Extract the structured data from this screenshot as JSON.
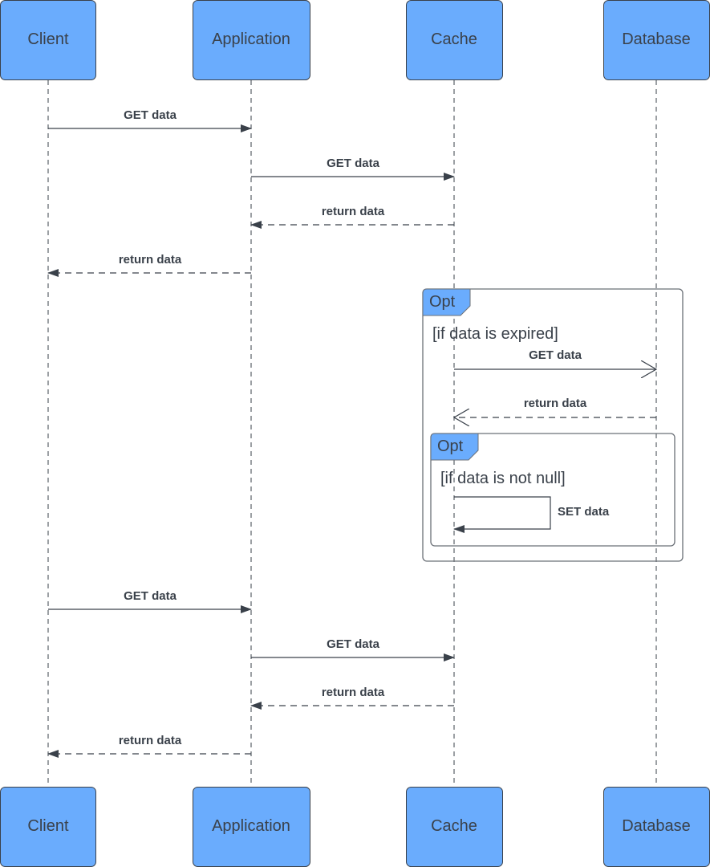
{
  "diagram": {
    "type": "sequence",
    "actors": [
      {
        "id": "client",
        "label": "Client"
      },
      {
        "id": "application",
        "label": "Application"
      },
      {
        "id": "cache",
        "label": "Cache"
      },
      {
        "id": "database",
        "label": "Database"
      }
    ],
    "messages": [
      {
        "label": "GET data",
        "from": "client",
        "to": "application",
        "style": "solid",
        "arrow": "filled"
      },
      {
        "label": "GET data",
        "from": "application",
        "to": "cache",
        "style": "solid",
        "arrow": "filled"
      },
      {
        "label": "return data",
        "from": "cache",
        "to": "application",
        "style": "dashed",
        "arrow": "filled"
      },
      {
        "label": "return data",
        "from": "application",
        "to": "client",
        "style": "dashed",
        "arrow": "filled"
      },
      {
        "label": "GET data",
        "from": "cache",
        "to": "database",
        "style": "solid",
        "arrow": "open"
      },
      {
        "label": "return data",
        "from": "database",
        "to": "cache",
        "style": "dashed",
        "arrow": "open"
      },
      {
        "label": "SET data",
        "from": "cache",
        "to": "cache",
        "style": "solid",
        "arrow": "filled"
      },
      {
        "label": "GET data",
        "from": "client",
        "to": "application",
        "style": "solid",
        "arrow": "filled"
      },
      {
        "label": "GET data",
        "from": "application",
        "to": "cache",
        "style": "solid",
        "arrow": "filled"
      },
      {
        "label": "return data",
        "from": "cache",
        "to": "application",
        "style": "dashed",
        "arrow": "filled"
      },
      {
        "label": "return data",
        "from": "application",
        "to": "client",
        "style": "dashed",
        "arrow": "filled"
      }
    ],
    "fragments": [
      {
        "kind": "Opt",
        "guard": "[if data is expired]"
      },
      {
        "kind": "Opt",
        "guard": "[if data is not null]"
      }
    ]
  }
}
